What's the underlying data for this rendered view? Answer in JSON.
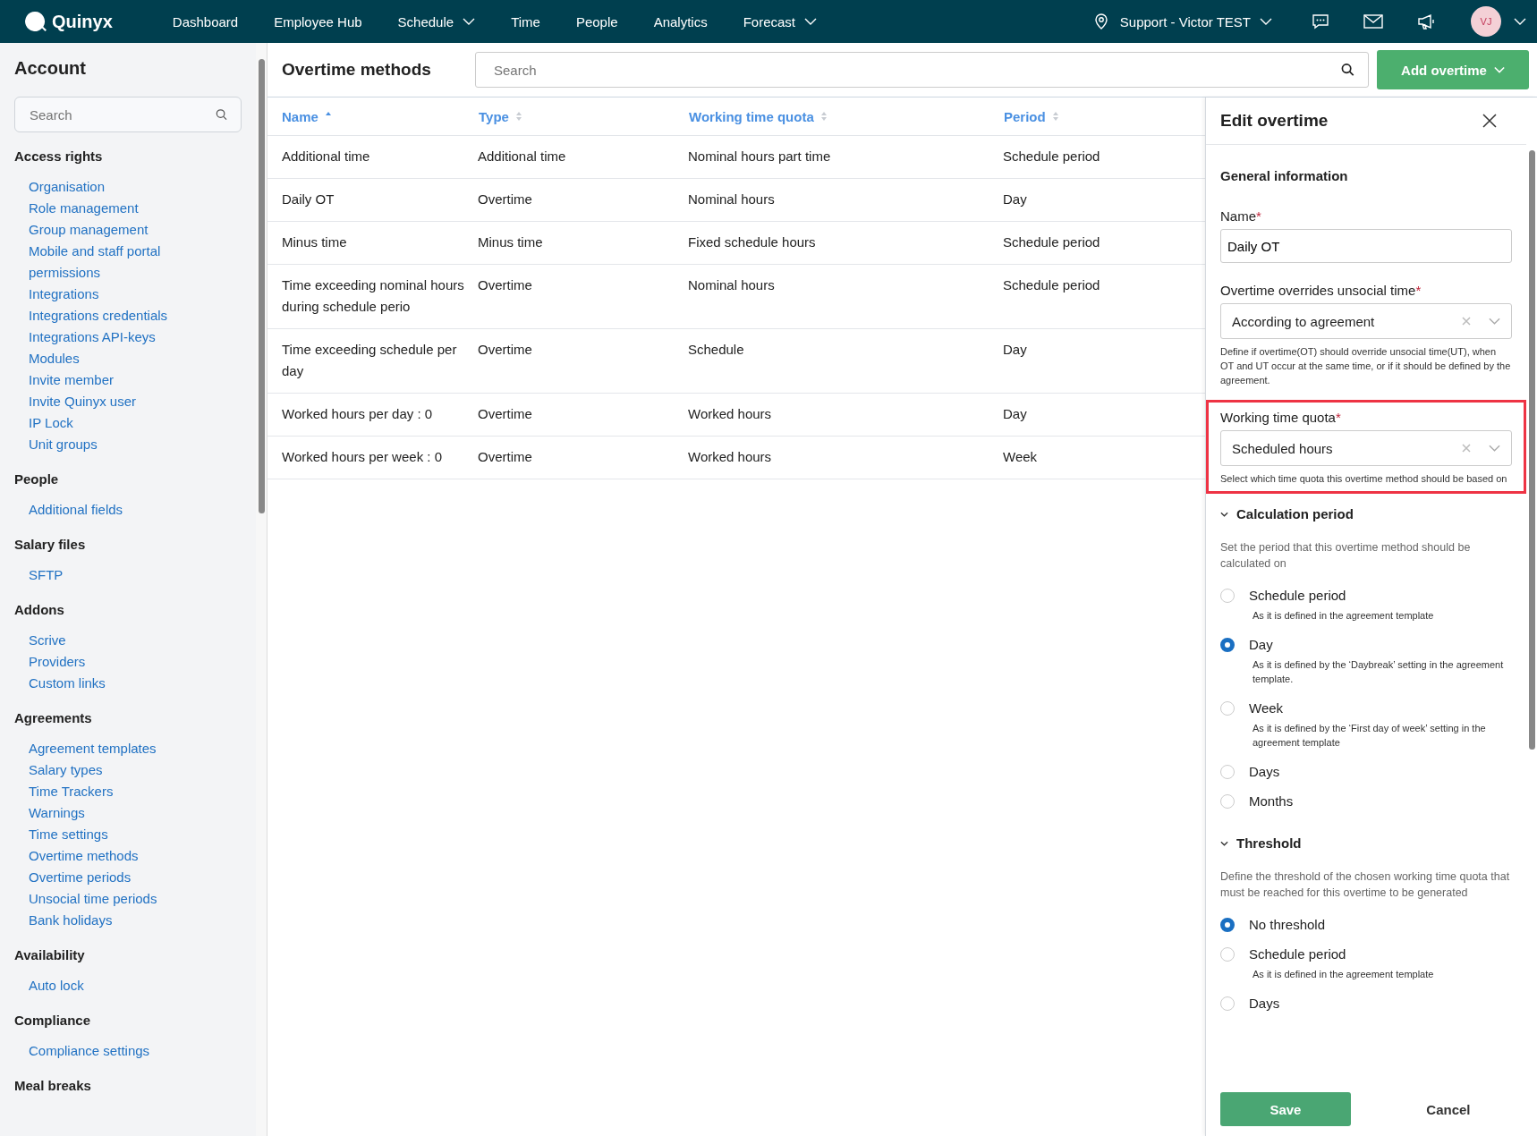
{
  "topbar": {
    "brand": "Quinyx",
    "nav": [
      {
        "label": "Dashboard",
        "dropdown": false
      },
      {
        "label": "Employee Hub",
        "dropdown": false
      },
      {
        "label": "Schedule",
        "dropdown": true
      },
      {
        "label": "Time",
        "dropdown": false
      },
      {
        "label": "People",
        "dropdown": false
      },
      {
        "label": "Analytics",
        "dropdown": false
      },
      {
        "label": "Forecast",
        "dropdown": true
      }
    ],
    "location": "Support - Victor TEST",
    "avatar": "VJ"
  },
  "sidebar": {
    "title": "Account",
    "search": {
      "placeholder": "Search"
    },
    "sections": [
      {
        "heading": "Access rights",
        "items": [
          "Organisation",
          "Role management",
          "Group management",
          "Mobile and staff portal permissions",
          "Integrations",
          "Integrations credentials",
          "Integrations API-keys",
          "Modules",
          "Invite member",
          "Invite Quinyx user",
          "IP Lock",
          "Unit groups"
        ]
      },
      {
        "heading": "People",
        "items": [
          "Additional fields"
        ]
      },
      {
        "heading": "Salary files",
        "items": [
          "SFTP"
        ]
      },
      {
        "heading": "Addons",
        "items": [
          "Scrive",
          "Providers",
          "Custom links"
        ]
      },
      {
        "heading": "Agreements",
        "items": [
          "Agreement templates",
          "Salary types",
          "Time Trackers",
          "Warnings",
          "Time settings",
          "Overtime methods",
          "Overtime periods",
          "Unsocial time periods",
          "Bank holidays"
        ]
      },
      {
        "heading": "Availability",
        "items": [
          "Auto lock"
        ]
      },
      {
        "heading": "Compliance",
        "items": [
          "Compliance settings"
        ]
      },
      {
        "heading": "Meal breaks"
      }
    ]
  },
  "main": {
    "title": "Overtime methods",
    "search": {
      "placeholder": "Search"
    },
    "add_button": "Add overtime",
    "table": {
      "columns": [
        {
          "label": "Name",
          "sorted": true
        },
        {
          "label": "Type",
          "sorted": false
        },
        {
          "label": "Working time quota",
          "sorted": false
        },
        {
          "label": "Period",
          "sorted": false
        }
      ],
      "rows": [
        [
          "Additional time",
          "Additional time",
          "Nominal hours part time",
          "Schedule period"
        ],
        [
          "Daily OT",
          "Overtime",
          "Nominal hours",
          "Day"
        ],
        [
          "Minus time",
          "Minus time",
          "Fixed schedule hours",
          "Schedule period"
        ],
        [
          "Time exceeding nominal hours during schedule perio",
          "Overtime",
          "Nominal hours",
          "Schedule period"
        ],
        [
          "Time exceeding schedule per day",
          "Overtime",
          "Schedule",
          "Day"
        ],
        [
          "Worked hours per day : 0",
          "Overtime",
          "Worked hours",
          "Day"
        ],
        [
          "Worked hours per week : 0",
          "Overtime",
          "Worked hours",
          "Week"
        ]
      ]
    }
  },
  "panel": {
    "title": "Edit overtime",
    "general_heading": "General information",
    "fields": [
      {
        "label": "Name",
        "required_mark": "*",
        "kind": "text",
        "value": "Daily OT",
        "highlighted": false
      },
      {
        "label": "Overtime overrides unsocial time",
        "required_mark": "*",
        "kind": "select",
        "value": "According to agreement",
        "help": "Define if overtime(OT) should override unsocial time(UT), when OT and UT occur at the same time, or if it should be defined by the agreement.",
        "highlighted": false
      },
      {
        "label": "Working time quota",
        "required_mark": "*",
        "kind": "select",
        "value": "Scheduled hours",
        "help": "Select which time quota this overtime method should be based on",
        "highlighted": true
      }
    ],
    "sections": [
      {
        "heading": "Calculation period",
        "expanded": true,
        "description": "Set the period that this overtime method should be calculated on",
        "options": [
          {
            "label": "Schedule period",
            "hint": "As it is defined in the agreement template",
            "selected": false
          },
          {
            "label": "Day",
            "hint": "As it is defined by the ‘Daybreak’ setting in the agreement template.",
            "selected": true
          },
          {
            "label": "Week",
            "hint": "As it is defined by the ‘First day of week’ setting in the agreement template",
            "selected": false
          },
          {
            "label": "Days",
            "selected": false
          },
          {
            "label": "Months",
            "selected": false
          }
        ]
      },
      {
        "heading": "Threshold",
        "expanded": true,
        "description": "Define the threshold of the chosen working time quota that must be reached for this overtime to be generated",
        "options": [
          {
            "label": "No threshold",
            "selected": true
          },
          {
            "label": "Schedule period",
            "hint": "As it is defined in the agreement template",
            "selected": false
          },
          {
            "label": "Days",
            "selected": false
          }
        ]
      }
    ],
    "save": "Save",
    "cancel": "Cancel"
  }
}
